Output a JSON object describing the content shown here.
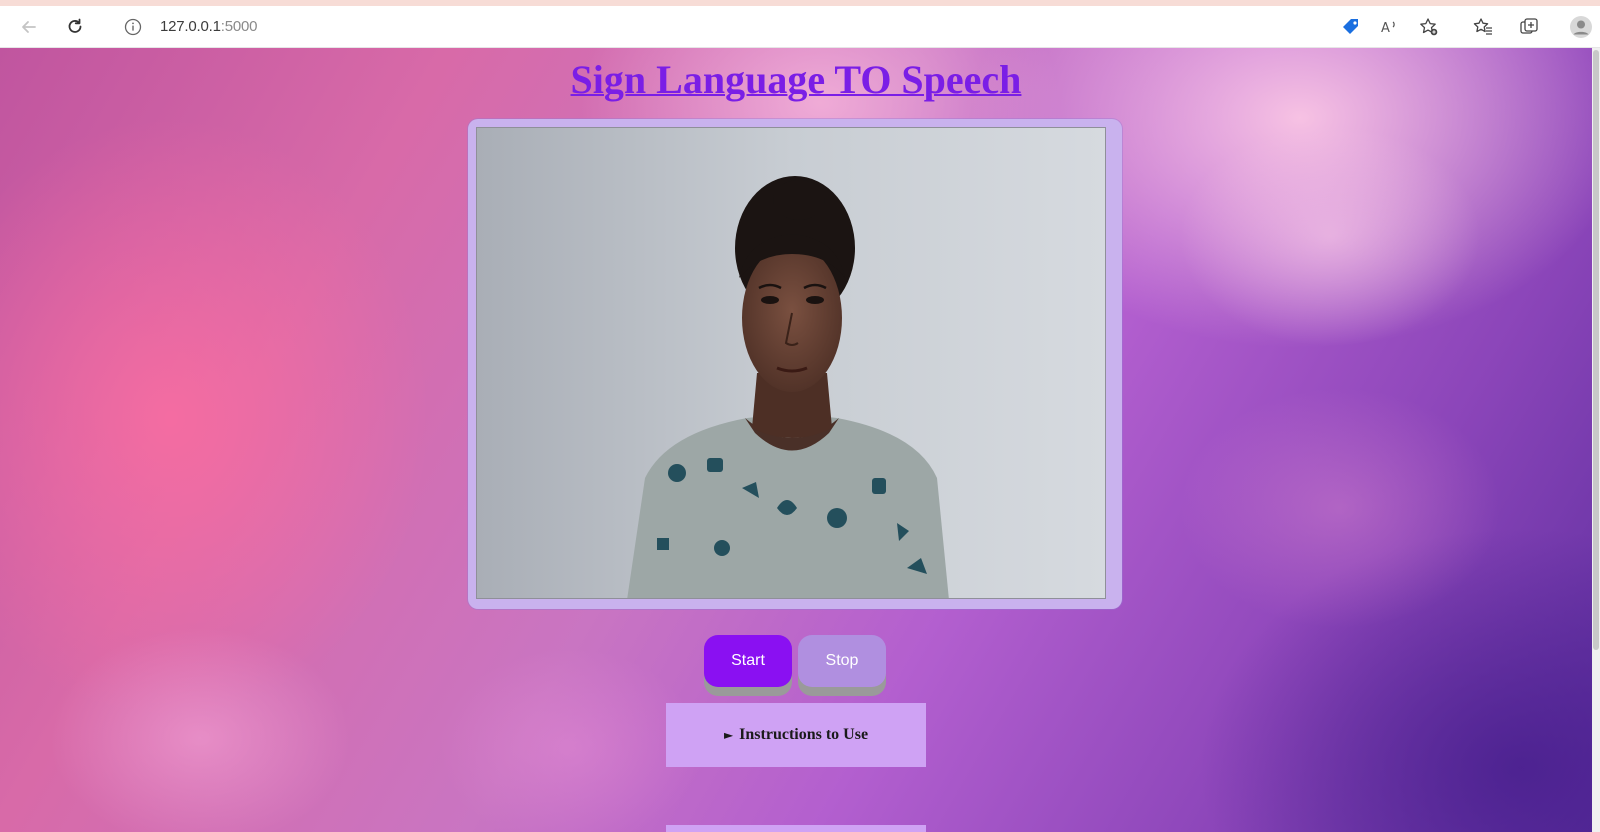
{
  "browser": {
    "address_host": "127.0.0.1",
    "address_port": ":5000",
    "icons": [
      "back-icon",
      "refresh-icon",
      "info-icon",
      "coupon-icon",
      "read-aloud-icon",
      "add-favorite-icon",
      "favorites-icon",
      "collections-icon",
      "profile-icon"
    ]
  },
  "page": {
    "title": "Sign Language TO Speech",
    "video": {
      "description_icon": "webcam-feed"
    },
    "buttons": {
      "start_label": "Start",
      "stop_label": "Stop"
    },
    "instructions": {
      "marker": "►",
      "label": "Instructions to Use"
    }
  },
  "colors": {
    "title": "#7a1ee6",
    "start_button": "#8a10f2",
    "stop_button": "#b08fe0",
    "panel": "#cfa2f4",
    "video_frame": "#c9b2ee"
  }
}
